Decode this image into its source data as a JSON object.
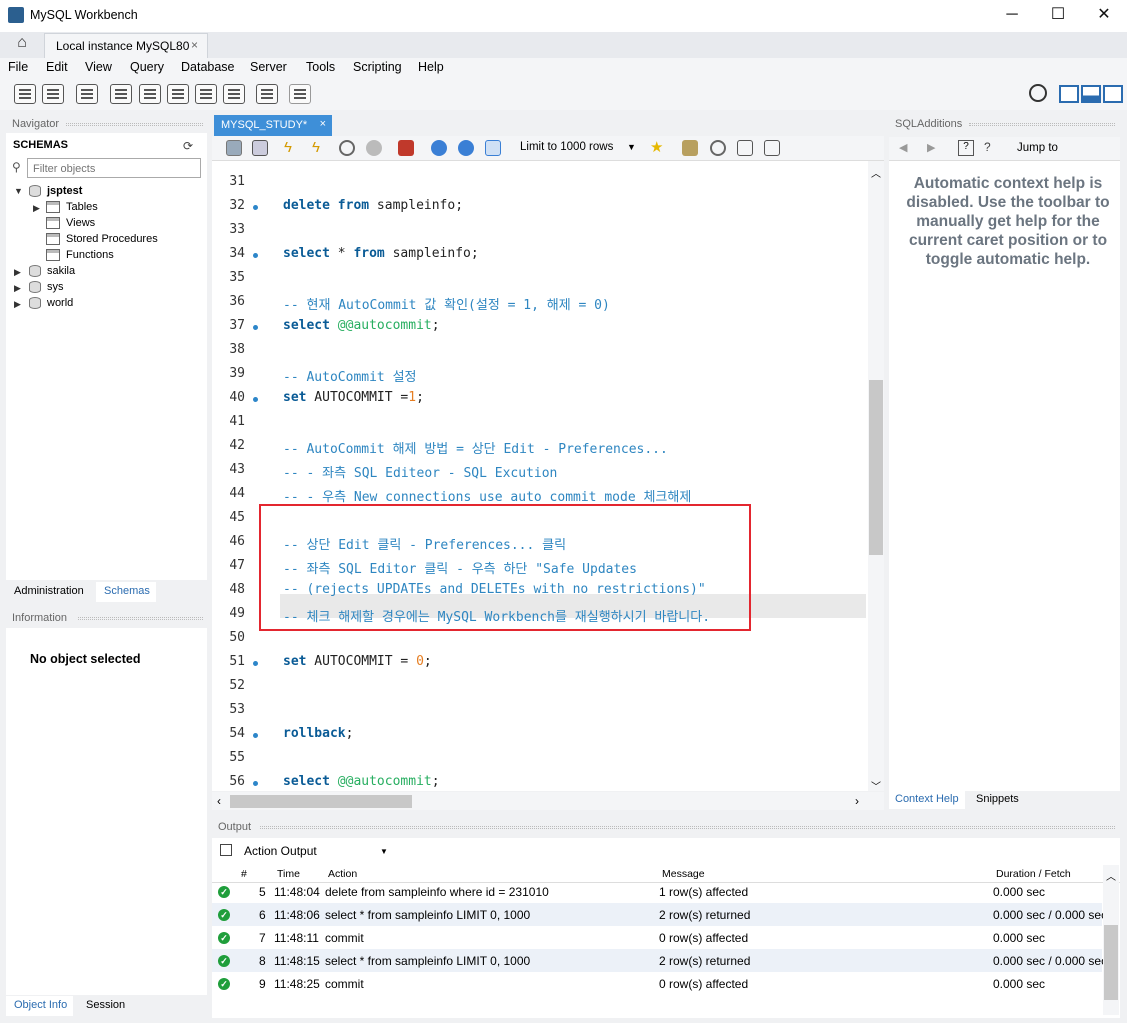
{
  "window": {
    "title": "MySQL Workbench",
    "minimize": "─",
    "maximize": "☐",
    "close": "✕"
  },
  "connection_tab": {
    "label": "Local instance MySQL80",
    "close": "×"
  },
  "menu": [
    "File",
    "Edit",
    "View",
    "Query",
    "Database",
    "Server",
    "Tools",
    "Scripting",
    "Help"
  ],
  "navigator": {
    "header": "Navigator",
    "schemas_label": "SCHEMAS",
    "filter_placeholder": "Filter objects",
    "schemas": [
      {
        "name": "jsptest",
        "expanded": true,
        "children": [
          "Tables",
          "Views",
          "Stored Procedures",
          "Functions"
        ]
      },
      {
        "name": "sakila"
      },
      {
        "name": "sys"
      },
      {
        "name": "world"
      }
    ],
    "tabs": [
      "Administration",
      "Schemas"
    ]
  },
  "information": {
    "header": "Information",
    "empty_text": "No object selected",
    "tabs": [
      "Object Info",
      "Session"
    ]
  },
  "editor": {
    "tab_label": "MYSQL_STUDY*",
    "tab_close": "×",
    "limit_label": "Limit to 1000 rows",
    "lines": [
      {
        "n": "31",
        "html": ""
      },
      {
        "n": "32",
        "html": "<span class='kw'>delete</span> <span class='kw'>from</span> sampleinfo;",
        "dot": true
      },
      {
        "n": "33",
        "html": ""
      },
      {
        "n": "34",
        "html": "<span class='kw'>select</span> * <span class='kw'>from</span> sampleinfo;",
        "dot": true
      },
      {
        "n": "35",
        "html": ""
      },
      {
        "n": "36",
        "html": "<span class='cm'>-- 현재 AutoCommit 값 확인(설정 = 1, 해제 = 0)</span>"
      },
      {
        "n": "37",
        "html": "<span class='kw'>select</span> <span class='at'>@@autocommit</span>;",
        "dot": true
      },
      {
        "n": "38",
        "html": ""
      },
      {
        "n": "39",
        "html": "<span class='cm'>-- AutoCommit 설정</span>"
      },
      {
        "n": "40",
        "html": "<span class='kw'>set</span> AUTOCOMMIT =<span class='nm'>1</span>;",
        "dot": true
      },
      {
        "n": "41",
        "html": ""
      },
      {
        "n": "42",
        "html": "<span class='cm'>-- AutoCommit 해제 방법 = 상단 Edit - Preferences...</span>"
      },
      {
        "n": "43",
        "html": "<span class='cm'>-- - 좌측 SQL Editeor - SQL Excution</span>"
      },
      {
        "n": "44",
        "html": "<span class='cm'>-- - 우측 New connections use auto commit mode 체크해제</span>"
      },
      {
        "n": "45",
        "html": ""
      },
      {
        "n": "46",
        "html": "<span class='cm'>-- 상단 Edit 클릭 - Preferences... 클릭</span>"
      },
      {
        "n": "47",
        "html": "<span class='cm'>-- 좌측 SQL Editor 클릭 - 우측 하단 \"Safe Updates</span>"
      },
      {
        "n": "48",
        "html": "<span class='cm'>-- (rejects UPDATEs and DELETEs with no restrictions)\"</span>"
      },
      {
        "n": "49",
        "html": "<span class='cm'>-- 체크 해제할 경우에는 MySQL Workbench를 재실행하시기 바랍니다.</span>"
      },
      {
        "n": "50",
        "html": ""
      },
      {
        "n": "51",
        "html": "<span class='kw'>set</span> AUTOCOMMIT = <span class='nm'>0</span>;",
        "dot": true
      },
      {
        "n": "52",
        "html": ""
      },
      {
        "n": "53",
        "html": ""
      },
      {
        "n": "54",
        "html": "<span class='kw'>rollback</span>;",
        "dot": true
      },
      {
        "n": "55",
        "html": ""
      },
      {
        "n": "56",
        "html": "<span class='kw'>select</span> <span class='at'>@@autocommit</span>;",
        "dot": true
      }
    ]
  },
  "sql_additions": {
    "header": "SQLAdditions",
    "jump_to": "Jump to",
    "help_text": [
      "Automatic context help is",
      "disabled. Use the toolbar to",
      "manually get help for the",
      "current caret position or to",
      "toggle automatic help."
    ],
    "tabs": [
      "Context Help",
      "Snippets"
    ]
  },
  "output": {
    "header": "Output",
    "selector": "Action Output",
    "columns": [
      "#",
      "Time",
      "Action",
      "Message",
      "Duration / Fetch"
    ],
    "rows": [
      {
        "num": "5",
        "time": "11:48:04",
        "action": "delete from sampleinfo where id = 231010",
        "message": "1 row(s) affected",
        "duration": "0.000 sec"
      },
      {
        "num": "6",
        "time": "11:48:06",
        "action": "select * from sampleinfo LIMIT 0, 1000",
        "message": "2 row(s) returned",
        "duration": "0.000 sec / 0.000 sec"
      },
      {
        "num": "7",
        "time": "11:48:11",
        "action": "commit",
        "message": "0 row(s) affected",
        "duration": "0.000 sec"
      },
      {
        "num": "8",
        "time": "11:48:15",
        "action": "select * from sampleinfo LIMIT 0, 1000",
        "message": "2 row(s) returned",
        "duration": "0.000 sec / 0.000 sec"
      },
      {
        "num": "9",
        "time": "11:48:25",
        "action": "commit",
        "message": "0 row(s) affected",
        "duration": "0.000 sec"
      }
    ]
  }
}
